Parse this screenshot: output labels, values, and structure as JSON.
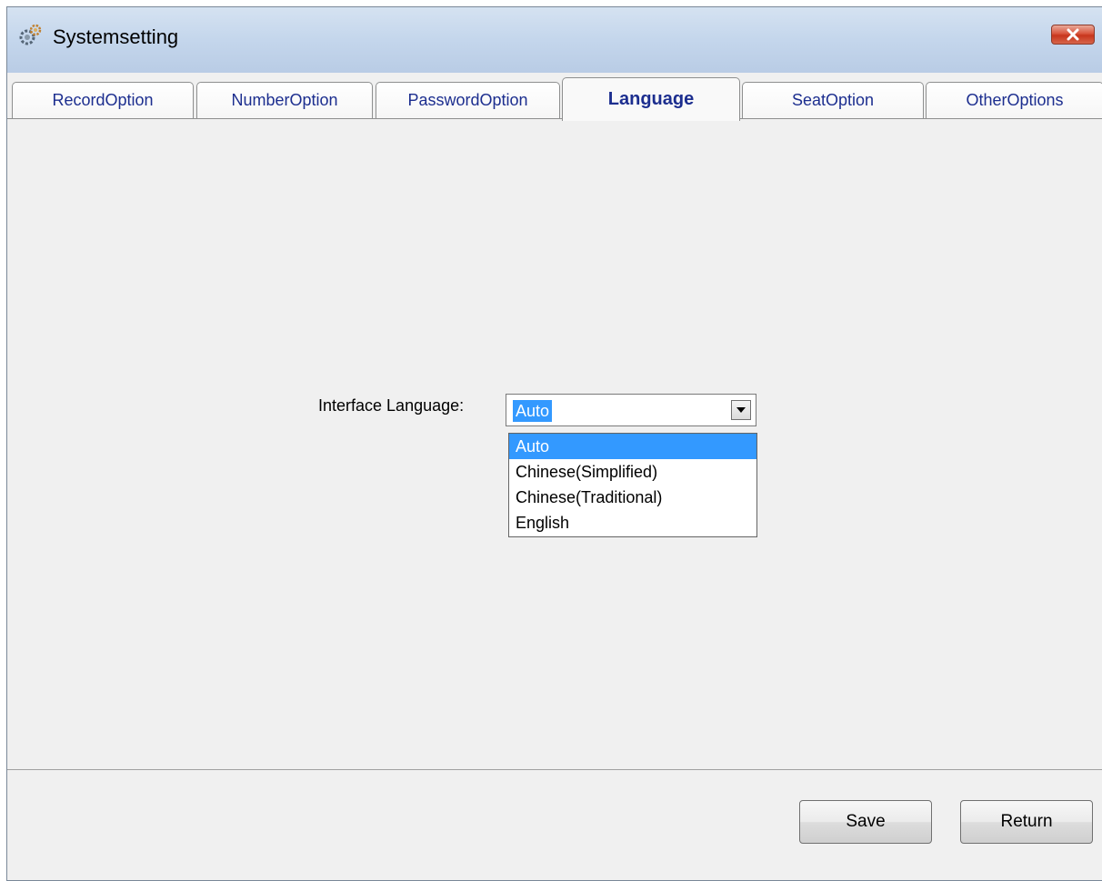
{
  "window": {
    "title": "Systemsetting",
    "title_icon": "gear-icon",
    "close_icon": "close-icon"
  },
  "tabs": [
    {
      "label": "RecordOption",
      "active": false
    },
    {
      "label": "NumberOption",
      "active": false
    },
    {
      "label": "PasswordOption",
      "active": false
    },
    {
      "label": "Language",
      "active": true
    },
    {
      "label": "SeatOption",
      "active": false
    },
    {
      "label": "OtherOptions",
      "active": false
    }
  ],
  "language": {
    "label": "Interface Language:",
    "selected": "Auto",
    "options": [
      "Auto",
      "Chinese(Simplified)",
      "Chinese(Traditional)",
      "English"
    ],
    "highlighted_option": "Auto"
  },
  "buttons": {
    "save": "Save",
    "return": "Return"
  },
  "colors": {
    "tab_text": "#1c2e8f",
    "selection": "#3399ff",
    "close_button": "#d9553c",
    "titlebar": "#c4d6ec"
  }
}
